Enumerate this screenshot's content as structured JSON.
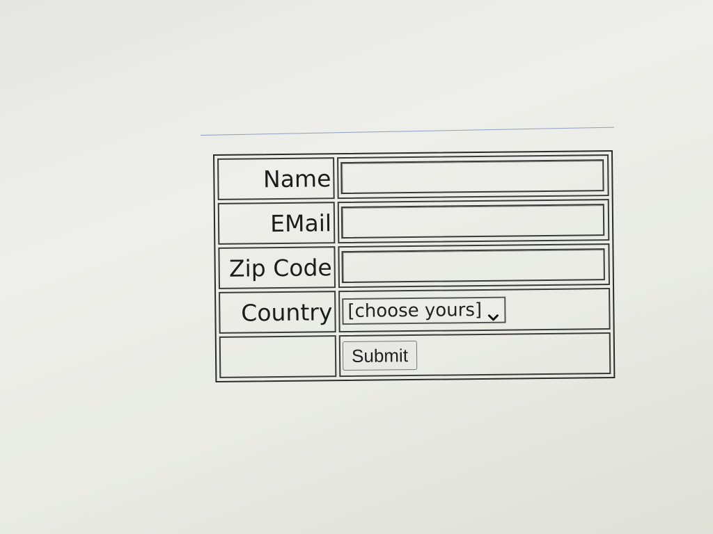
{
  "form": {
    "name_label": "Name",
    "name_value": "",
    "email_label": "EMail",
    "email_value": "",
    "zip_label": "Zip Code",
    "zip_value": "",
    "country_label": "Country",
    "country_selected": "[choose yours]",
    "country_dropdown_icon": "chevron-down-icon",
    "submit_label": "Submit"
  },
  "colors": {
    "background": "#eeeeea",
    "border": "#2b2b2b",
    "rule_line": "#8fa0c4",
    "text": "#1c1c1c"
  }
}
